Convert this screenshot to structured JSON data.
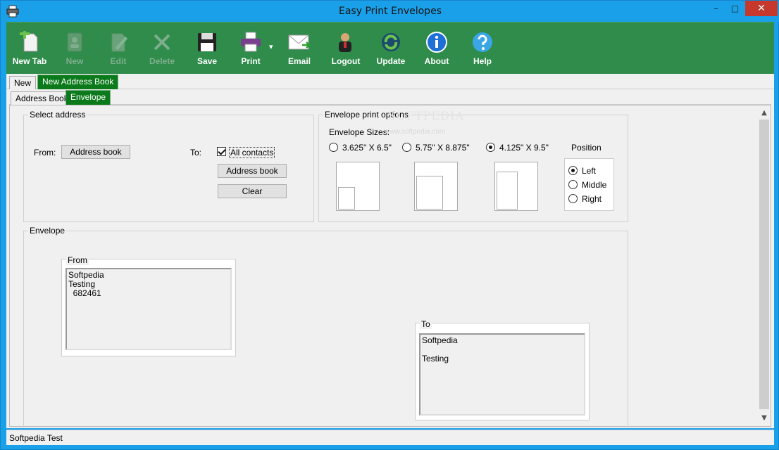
{
  "window": {
    "title": "Easy Print Envelopes",
    "minimize": "–",
    "maximize": "□",
    "close": "✕"
  },
  "toolbar": {
    "new_tab": "New Tab",
    "new": "New",
    "edit": "Edit",
    "delete": "Delete",
    "save": "Save",
    "print": "Print",
    "print_arrow": "▾",
    "email": "Email",
    "logout": "Logout",
    "update": "Update",
    "about": "About",
    "help": "Help"
  },
  "tabs_top": [
    "New",
    "New Address Book"
  ],
  "tabs_sub": [
    "Address Book",
    "Envelope"
  ],
  "select_address": {
    "title": "Select address",
    "from_label": "From:",
    "from_button": "Address book",
    "to_label": "To:",
    "all_contacts": "All contacts",
    "to_button": "Address book",
    "clear_button": "Clear"
  },
  "envelope_options": {
    "title": "Envelope print options",
    "sizes_label": "Envelope Sizes:",
    "sizes": [
      "3.625\" X 6.5\"",
      "5.75\" X 8.875\"",
      "4.125\" X 9.5\""
    ],
    "selected_size": 2,
    "position_label": "Position",
    "positions": [
      "Left",
      "Middle",
      "Right"
    ],
    "selected_position": 0
  },
  "envelope": {
    "title": "Envelope",
    "from_title": "From",
    "from_text": "Softpedia\nTesting\n  682461",
    "to_title": "To",
    "to_text": "Softpedia\n\nTesting"
  },
  "scroll": {
    "up": "▲",
    "down": "▼"
  },
  "status": {
    "text": "Softpedia Test"
  },
  "watermark": "SOFTPEDIA",
  "watermark_url": "www.softpedia.com",
  "colors": {
    "toolbar": "#2f8c4b",
    "titlebar": "#1aa0e8",
    "tab_active": "#0b7a1a",
    "close": "#c7382c"
  }
}
